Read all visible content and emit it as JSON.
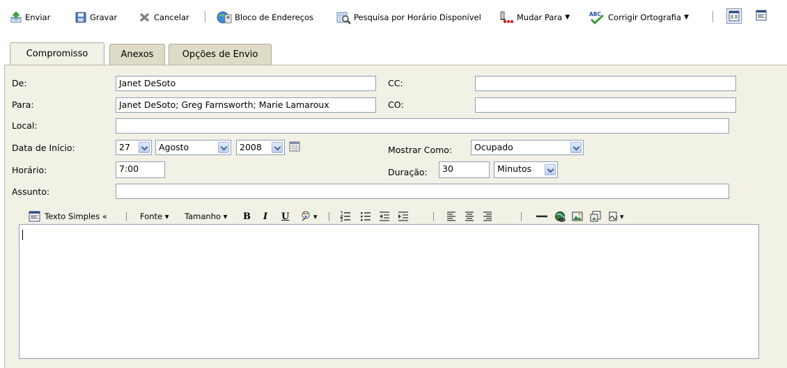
{
  "toolbar": {
    "send": "Enviar",
    "save": "Gravar",
    "cancel": "Cancelar",
    "address_book": "Bloco de Endereços",
    "free_time_search": "Pesquisa por Horário Disponível",
    "change_to": "Mudar Para",
    "spell_check": "Corrigir Ortografia",
    "dropdown_glyph": "▼"
  },
  "tabs": [
    {
      "label": "Compromisso",
      "active": true
    },
    {
      "label": "Anexos",
      "active": false
    },
    {
      "label": "Opções de Envio",
      "active": false
    }
  ],
  "form": {
    "from_label": "De:",
    "from_value": "Janet DeSoto",
    "to_label": "Para:",
    "to_value": "Janet DeSoto; Greg Farnsworth; Marie Lamaroux",
    "cc_label": "CC:",
    "cc_value": "",
    "bc_label": "CO:",
    "bc_value": "",
    "place_label": "Local:",
    "place_value": "",
    "start_date_label": "Data de Início:",
    "day": "27",
    "month": "Agosto",
    "year": "2008",
    "show_as_label": "Mostrar Como:",
    "show_as_value": "Ocupado",
    "time_label": "Horário:",
    "time_value": "7:00",
    "duration_label": "Duração:",
    "duration_value": "30",
    "duration_unit": "Minutos",
    "subject_label": "Assunto:",
    "subject_value": ""
  },
  "editor_toolbar": {
    "plain_text": "Texto Simples «",
    "font": "Fonte ▾",
    "size": "Tamanho ▾",
    "bold": "B",
    "italic": "I",
    "underline": "U",
    "color_arrow": "▾",
    "signature_arrow": "▾"
  },
  "colors": {
    "panel_bg": "#f2f1e6",
    "tab_inactive": "#dddcc6",
    "input_border": "#8f9db5"
  }
}
